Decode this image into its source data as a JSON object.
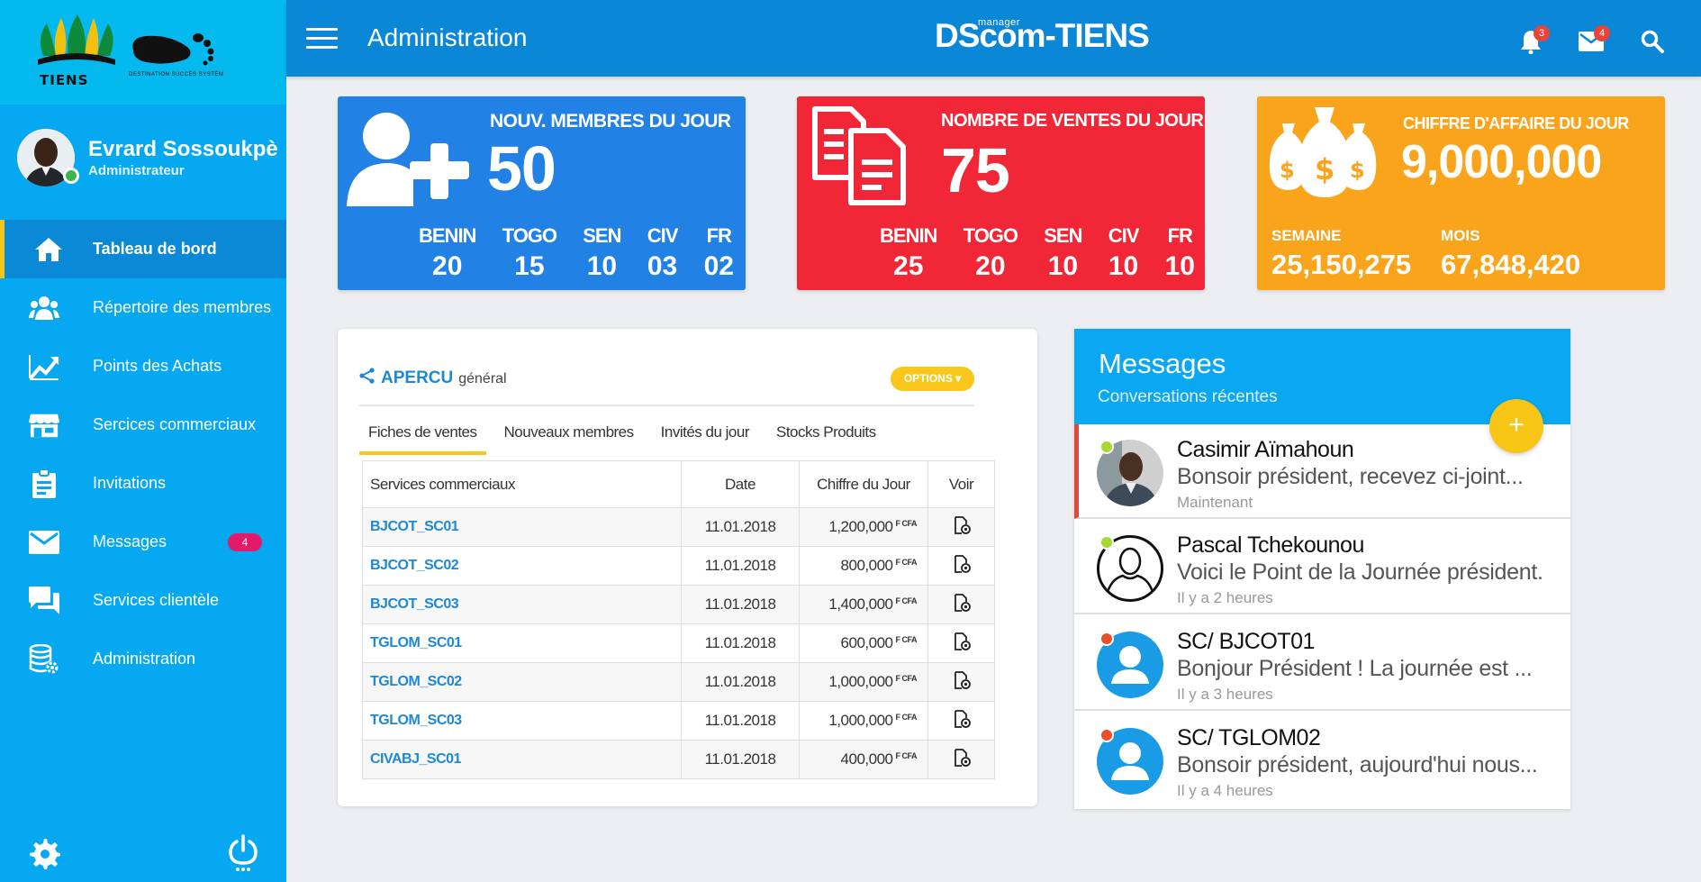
{
  "brand": {
    "logo_text": "TIENS",
    "foot_tagline": "DESTINATION SUCCÈS SYSTÈM",
    "app_name": "DScom-TIENS",
    "app_super": "manager"
  },
  "user": {
    "name": "Evrard Sossoukpè",
    "role": "Administrateur"
  },
  "sidebar": {
    "items": [
      {
        "label": "Tableau de bord",
        "icon": "home-icon",
        "active": true
      },
      {
        "label": "Répertoire des membres",
        "icon": "users-icon"
      },
      {
        "label": "Points des Achats",
        "icon": "chart-line-icon"
      },
      {
        "label": "Sercices commerciaux",
        "icon": "store-icon"
      },
      {
        "label": "Invitations",
        "icon": "clipboard-icon"
      },
      {
        "label": "Messages",
        "icon": "mail-icon",
        "badge": "4"
      },
      {
        "label": "Services clientèle",
        "icon": "chat-icon"
      },
      {
        "label": "Administration",
        "icon": "database-gear-icon"
      }
    ]
  },
  "header": {
    "title": "Administration",
    "notifications_count": "3",
    "messages_count": "4"
  },
  "colors": {
    "primary": "#0a87d6",
    "sidebar": "#06a9f1",
    "blue_card": "#2281e4",
    "red_card": "#f12636",
    "orange_card": "#f9a41b",
    "accent_yellow": "#f9c71b"
  },
  "cards": {
    "members": {
      "title": "NOUV. MEMBRES DU JOUR",
      "value": "50",
      "countries": [
        {
          "name": "BENIN",
          "value": "20"
        },
        {
          "name": "TOGO",
          "value": "15"
        },
        {
          "name": "SEN",
          "value": "10"
        },
        {
          "name": "CIV",
          "value": "03"
        },
        {
          "name": "FR",
          "value": "02"
        }
      ]
    },
    "sales": {
      "title": "NOMBRE DE VENTES DU JOUR",
      "value": "75",
      "countries": [
        {
          "name": "BENIN",
          "value": "25"
        },
        {
          "name": "TOGO",
          "value": "20"
        },
        {
          "name": "SEN",
          "value": "10"
        },
        {
          "name": "CIV",
          "value": "10"
        },
        {
          "name": "FR",
          "value": "10"
        }
      ]
    },
    "revenue": {
      "title": "CHIFFRE D'AFFAIRE DU JOUR",
      "value": "9,000,000",
      "week_label": "SEMAINE",
      "week_value": "25,150,275",
      "month_label": "MOIS",
      "month_value": "67,848,420"
    }
  },
  "overview": {
    "title": "APERCU",
    "subtitle": "général",
    "options_label": "OPTIONS ▾",
    "tabs": [
      "Fiches de ventes",
      "Nouveaux membres",
      "Invités du jour",
      "Stocks Produits"
    ],
    "columns": [
      "Services commerciaux",
      "Date",
      "Chiffre du Jour",
      "Voir"
    ],
    "currency": "F CFA",
    "rows": [
      {
        "code": "BJCOT_SC01",
        "date": "11.01.2018",
        "amount": "1,200,000"
      },
      {
        "code": "BJCOT_SC02",
        "date": "11.01.2018",
        "amount": "800,000"
      },
      {
        "code": "BJCOT_SC03",
        "date": "11.01.2018",
        "amount": "1,400,000"
      },
      {
        "code": "TGLOM_SC01",
        "date": "11.01.2018",
        "amount": "600,000"
      },
      {
        "code": "TGLOM_SC02",
        "date": "11.01.2018",
        "amount": "1,000,000"
      },
      {
        "code": "TGLOM_SC03",
        "date": "11.01.2018",
        "amount": "1,000,000"
      },
      {
        "code": "CIVABJ_SC01",
        "date": "11.01.2018",
        "amount": "400,000"
      }
    ]
  },
  "messages": {
    "title": "Messages",
    "subtitle": "Conversations récentes",
    "fab_label": "+",
    "items": [
      {
        "name": "Casimir Aïmahoun",
        "text": "Bonsoir président, recevez ci-joint...",
        "time": "Maintenant",
        "status_color": "#a6d830",
        "unread": true,
        "avatar": "photo"
      },
      {
        "name": "Pascal Tchekounou",
        "text": "Voici le Point de la Journée président.",
        "time": "Il y a 2 heures",
        "status_color": "#a6d830",
        "avatar": "outline"
      },
      {
        "name": "SC/ BJCOT01",
        "text": "Bonjour Président ! La journée est ...",
        "time": "Il y a 3 heures",
        "status_color": "#e8502a",
        "avatar": "blue"
      },
      {
        "name": "SC/ TGLOM02",
        "text": "Bonsoir président, aujourd'hui nous...",
        "time": "Il y a 4 heures",
        "status_color": "#e8502a",
        "avatar": "blue"
      }
    ]
  }
}
